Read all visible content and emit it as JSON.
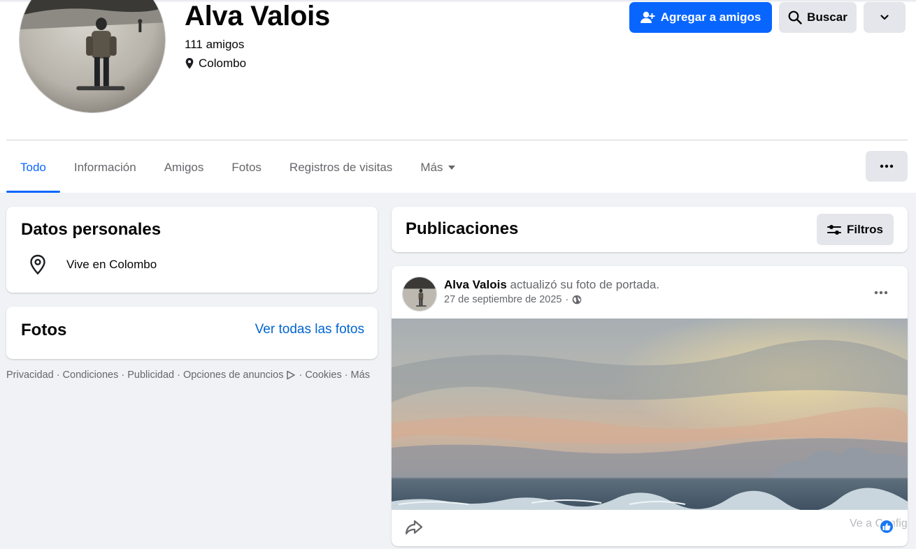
{
  "profile": {
    "name": "Alva Valois",
    "friends": "111 amigos",
    "location": "Colombo"
  },
  "header_buttons": {
    "add_friend": "Agregar a amigos",
    "search": "Buscar"
  },
  "tabs": [
    {
      "label": "Todo",
      "active": true
    },
    {
      "label": "Información",
      "active": false
    },
    {
      "label": "Amigos",
      "active": false
    },
    {
      "label": "Fotos",
      "active": false
    },
    {
      "label": "Registros de visitas",
      "active": false
    },
    {
      "label": "Más",
      "active": false
    }
  ],
  "personal": {
    "title": "Datos personales",
    "lives_in": "Vive en Colombo"
  },
  "photos": {
    "title": "Fotos",
    "see_all": "Ver todas las fotos"
  },
  "footer": {
    "links": [
      "Privacidad",
      "Condiciones",
      "Publicidad",
      "Opciones de anuncios",
      "Cookies",
      "Más"
    ],
    "separator": "·"
  },
  "posts": {
    "title": "Publicaciones",
    "filters": "Filtros"
  },
  "post": {
    "author": "Alva Valois",
    "action": " actualizó su foto de portada.",
    "date": "27 de septiembre de 2025",
    "date_separator": "·",
    "watermark": "Ve a Configu"
  },
  "colors": {
    "accent": "#0866ff",
    "link": "#0064d1",
    "secondary_text": "#65676b",
    "button_gray": "#e4e6eb",
    "page_bg": "#f0f2f5"
  },
  "icons": {
    "location": "map-pin-icon",
    "add_friend": "person-add-icon",
    "search": "magnifier-icon",
    "dropdown": "chevron-down-icon",
    "more": "ellipsis-icon",
    "filters": "sliders-icon",
    "audience": "globe-icon",
    "share": "share-arrow-icon",
    "like": "thumbs-up-icon"
  }
}
